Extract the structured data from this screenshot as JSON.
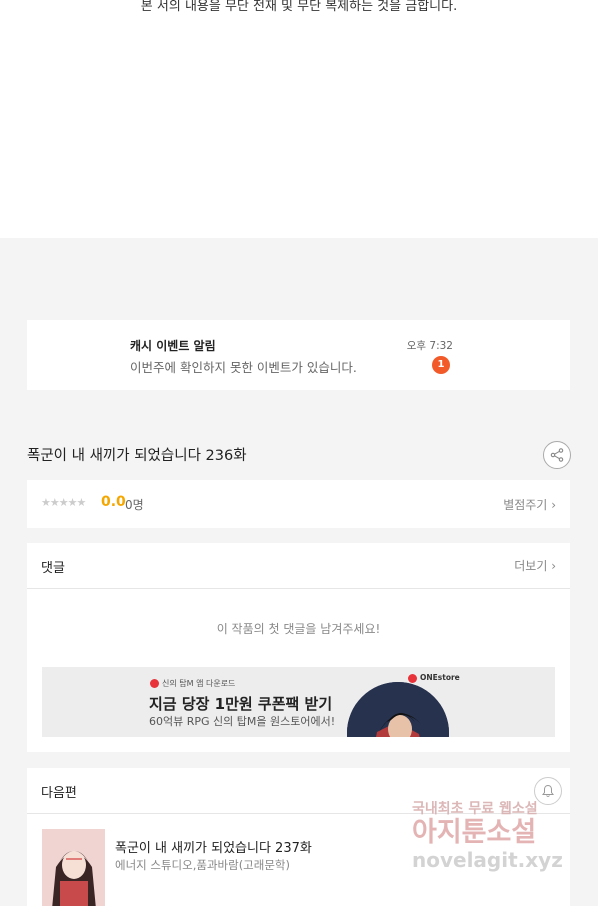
{
  "notice": "본 서의 내용을 무단 전재 및 무단 복제하는 것을 금합니다.",
  "notification": {
    "title": "캐시 이벤트 알림",
    "message": "이번주에 확인하지 못한 이벤트가 있습니다.",
    "time": "오후 7:32",
    "badge": "1"
  },
  "episode": {
    "title": "폭군이 내 새끼가 되었습니다 236화"
  },
  "rating": {
    "stars": "★★★★★",
    "score": "0.0",
    "count": "0명",
    "rate_label": "별점주기",
    "value": 0
  },
  "comments": {
    "header": "댓글",
    "more_label": "더보기",
    "empty_text": "이 작품의 첫 댓글을 남겨주세요!"
  },
  "ad": {
    "small": "신의 탑M 앱 다운로드",
    "headline": "지금 당장 1만원 쿠폰팩 받기",
    "sub": "60억뷰 RPG 신의 탑M을 원스토어에서!",
    "brand": "ONEstore"
  },
  "next": {
    "header": "다음편",
    "title": "폭군이 내 새끼가 되었습니다 237화",
    "author": "에너지 스튜디오,품과바람(고래문학)"
  },
  "watermark": {
    "line1": "국내최초 무료 웹소설",
    "line2": "아지툰소설",
    "line3": "novelagit.xyz"
  },
  "colors": {
    "accent_orange": "#f5a700",
    "badge_red": "#f25a2a"
  }
}
